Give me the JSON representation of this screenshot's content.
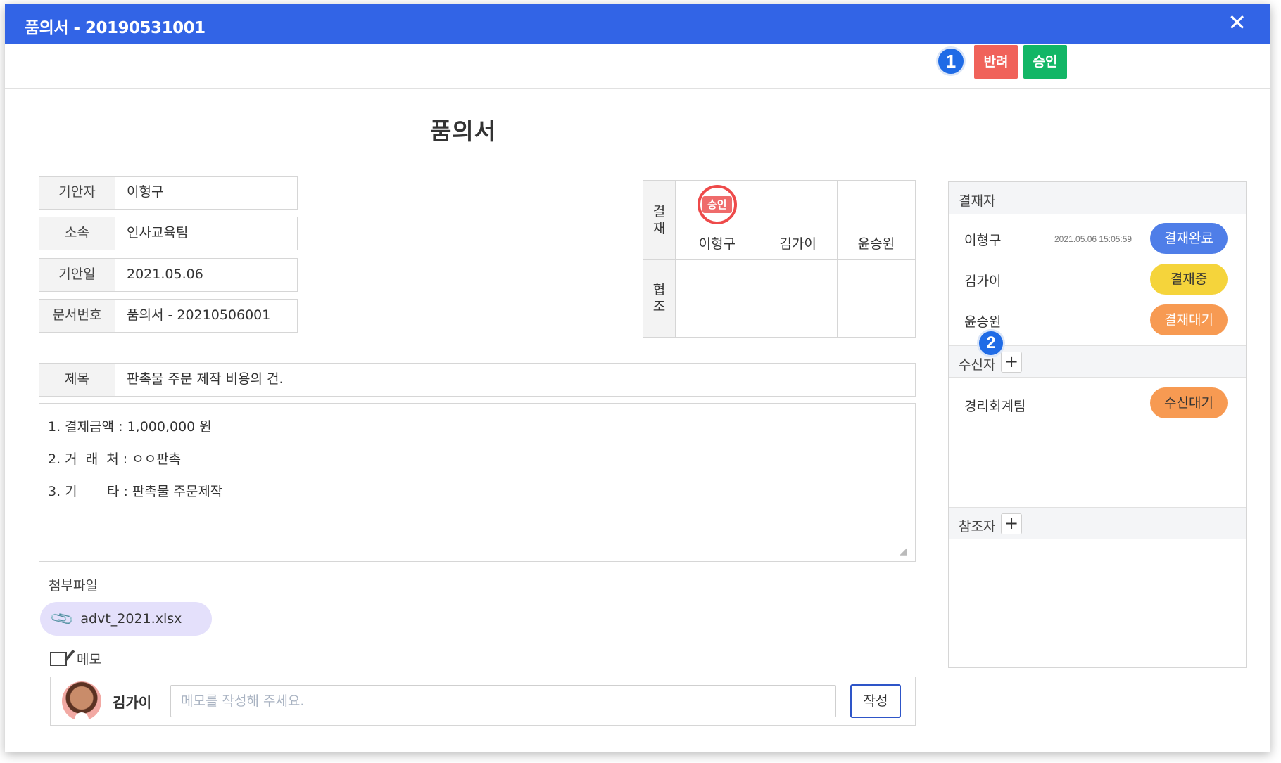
{
  "window": {
    "title": "품의서 - 20190531001",
    "close_glyph": "✕"
  },
  "toolbar": {
    "marker_1": "1",
    "reject_label": "반려",
    "approve_label": "승인",
    "reject_color": "#f0625a",
    "approve_color": "#12b666"
  },
  "document": {
    "heading": "품의서",
    "fields": [
      {
        "label": "기안자",
        "value": "이형구"
      },
      {
        "label": "소속",
        "value": "인사교육팀"
      },
      {
        "label": "기안일",
        "value": "2021.05.06"
      },
      {
        "label": "문서번호",
        "value": "품의서 - 20210506001"
      }
    ],
    "subject_label": "제목",
    "subject_value": "판촉물 주문 제작 비용의 건.",
    "body_lines": [
      "1. 결제금액 : 1,000,000 원",
      "2. 거  래  처 : ㅇㅇ판촉",
      "3. 기       타 : 판촉물 주문제작"
    ]
  },
  "approval_grid": {
    "row1_label": "결\n재",
    "row2_label": "협\n조",
    "stamp_text": "승인",
    "signers": [
      "이형구",
      "김가이",
      "윤승원"
    ]
  },
  "attachments": {
    "label": "첨부파일",
    "icon": "paperclip-icon",
    "file_name": "advt_2021.xlsx"
  },
  "memo": {
    "label": "메모",
    "icon": "memo-edit-icon",
    "author": "김가이",
    "placeholder": "메모를 작성해 주세요.",
    "submit_label": "작성"
  },
  "panel": {
    "approvers_title": "결재자",
    "approvers": [
      {
        "name": "이형구",
        "timestamp": "2021.05.06 15:05:59",
        "status": "결재완료",
        "color": "#4f7ee8"
      },
      {
        "name": "김가이",
        "timestamp": "",
        "status": "결재중",
        "color": "#f5d43b"
      },
      {
        "name": "윤승원",
        "timestamp": "",
        "status": "결재대기",
        "color": "#f79a52"
      }
    ],
    "marker_2": "2",
    "receivers_title": "수신자",
    "receivers": [
      {
        "name": "경리회계팀",
        "status": "수신대기",
        "color": "#f79a52"
      }
    ],
    "references_title": "참조자",
    "add_glyph": "+"
  }
}
